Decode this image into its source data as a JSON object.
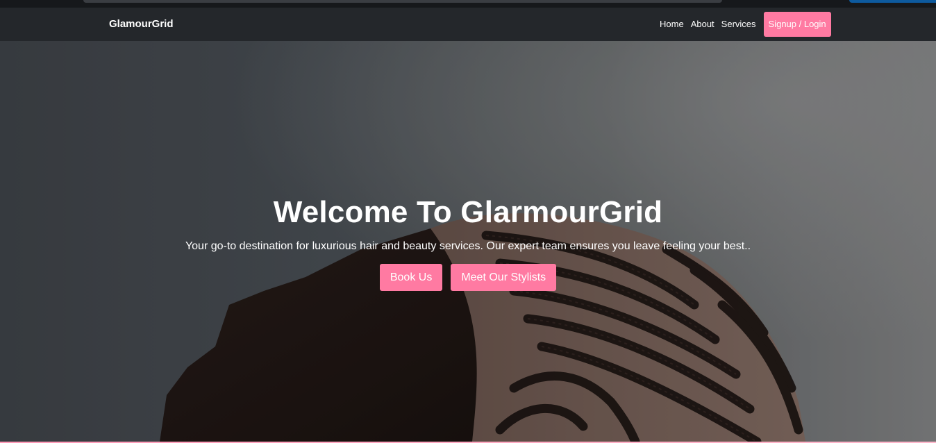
{
  "navbar": {
    "brand": "GlamourGrid",
    "links": [
      "Home",
      "About",
      "Services"
    ],
    "signup_label": "Signup / Login"
  },
  "hero": {
    "title": "Welcome To GlarmourGrid",
    "subtitle": "Your go-to destination for luxurious hair and beauty services. Our expert team ensures you leave feeling your best..",
    "book_label": "Book Us",
    "stylists_label": "Meet Our Stylists"
  },
  "colors": {
    "accent": "#ff7aa2",
    "navbar_bg": "#24272b"
  }
}
